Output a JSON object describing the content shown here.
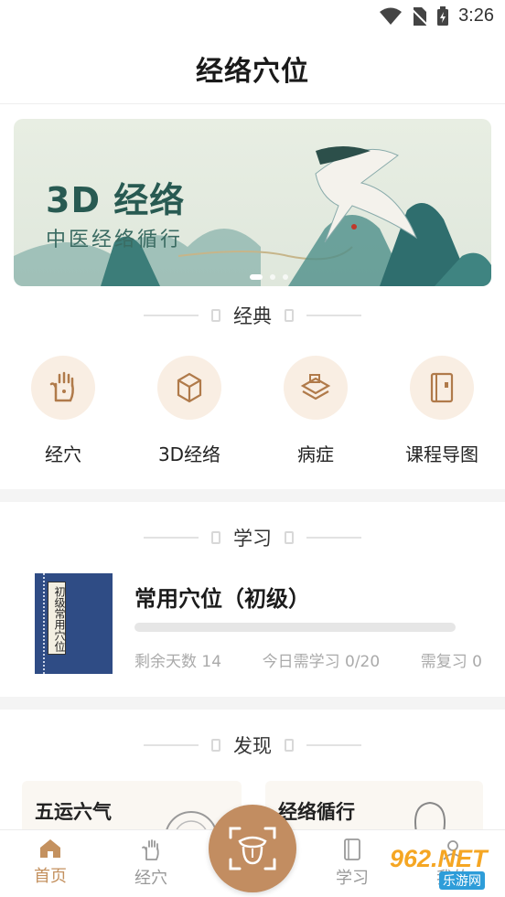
{
  "status_bar": {
    "time": "3:26",
    "icons": [
      "wifi-icon",
      "no-sim-icon",
      "battery-charging-icon"
    ]
  },
  "app": {
    "title": "经络穴位"
  },
  "banner": {
    "title": "3D 经络",
    "subtitle": "中医经络循行",
    "pages": 3,
    "active_page": 1
  },
  "classic": {
    "header": "经典",
    "items": [
      {
        "label": "经穴",
        "icon": "palm-icon"
      },
      {
        "label": "3D经络",
        "icon": "cube-icon"
      },
      {
        "label": "病症",
        "icon": "layers-icon"
      },
      {
        "label": "课程导图",
        "icon": "notebook-icon"
      }
    ]
  },
  "study": {
    "header": "学习",
    "course": {
      "cover_text": "初级常用穴位",
      "title": "常用穴位（初级）",
      "progress": 0,
      "remaining_days": "剩余天数 14",
      "today": "今日需学习 0/20",
      "review": "需复习 0"
    }
  },
  "discover": {
    "header": "发现",
    "cards": [
      {
        "title": "五运六气"
      },
      {
        "title": "经络循行"
      }
    ]
  },
  "tabbar": {
    "tabs": [
      {
        "label": "首页",
        "icon": "home-icon",
        "active": true
      },
      {
        "label": "经穴",
        "icon": "palm-icon",
        "active": false
      },
      {
        "label": "学习",
        "icon": "book-icon",
        "active": false
      },
      {
        "label": "我的",
        "icon": "user-icon",
        "active": false
      }
    ],
    "center_icon": "tongue-scan-icon"
  },
  "watermark": {
    "text": "962.NET",
    "sub": "乐游网"
  },
  "colors": {
    "accent": "#c28d61",
    "accent_light": "#f9eee3",
    "banner_green": "#285a52",
    "book_blue": "#2f4c85"
  }
}
